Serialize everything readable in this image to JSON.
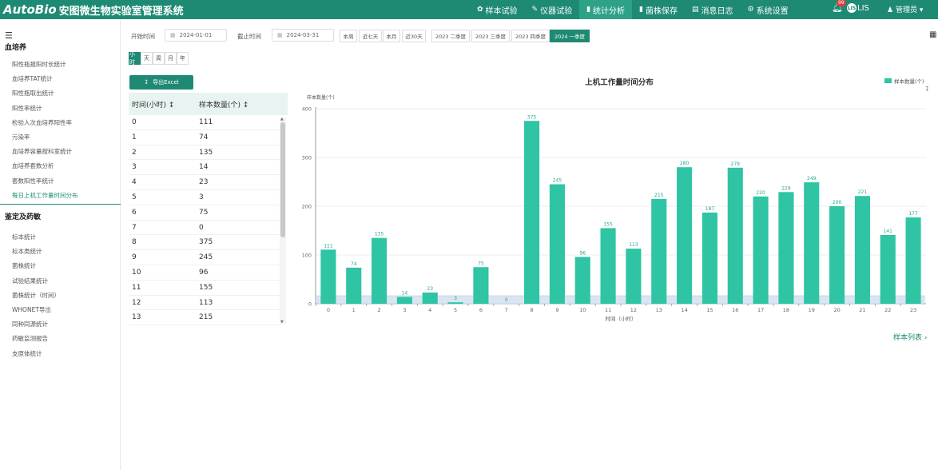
{
  "app": {
    "brand": "AutoBio",
    "system_name": "安图微生物实验室管理系统"
  },
  "nav": [
    {
      "icon": "flask-icon",
      "glyph": "✿",
      "label": "样本试验"
    },
    {
      "icon": "pen-icon",
      "glyph": "✎",
      "label": "仪器试验"
    },
    {
      "icon": "bar-chart-icon",
      "glyph": "▮",
      "label": "统计分析"
    },
    {
      "icon": "archive-icon",
      "glyph": "▮",
      "label": "菌株保存"
    },
    {
      "icon": "document-icon",
      "glyph": "▤",
      "label": "消息日志"
    },
    {
      "icon": "gear-icon",
      "glyph": "⚙",
      "label": "系统设置"
    }
  ],
  "header": {
    "bell_badge": "99",
    "lis_label": "LIS",
    "lis_badge": "LIS",
    "user": "管理员"
  },
  "sidebar": {
    "group1": "血培养",
    "group1_items": [
      "阳性瓶报阳时长统计",
      "血培养TAT统计",
      "阳性瓶取出统计",
      "阳性率统计",
      "检验人次血培养阳性率",
      "污染率",
      "血培养容量按科室统计",
      "血培养套数分析",
      "套数阳性率统计",
      "每日上机工作量时间分布"
    ],
    "group2": "鉴定及药敏",
    "group2_items": [
      "标本统计",
      "标本类统计",
      "菌株统计",
      "试验结果统计",
      "菌株统计（时间）",
      "WHONET导出",
      "同种同源统计",
      "药敏监测报告",
      "支原体统计"
    ]
  },
  "filters": {
    "start_label": "开始时间",
    "start_value": "2024-01-01",
    "end_label": "截止时间",
    "end_value": "2024-03-31",
    "quick": [
      "本周",
      "近七天",
      "本月",
      "近30天",
      "2023 二季度",
      "2023 三季度",
      "2023 四季度",
      "2024 一季度"
    ],
    "granularity": [
      "小时",
      "天",
      "周",
      "月",
      "年"
    ]
  },
  "export_label": "导出Excel",
  "table": {
    "headers": [
      "时间(小时)",
      "样本数量(个)"
    ],
    "rows": [
      [
        "0",
        "111"
      ],
      [
        "1",
        "74"
      ],
      [
        "2",
        "135"
      ],
      [
        "3",
        "14"
      ],
      [
        "4",
        "23"
      ],
      [
        "5",
        "3"
      ],
      [
        "6",
        "75"
      ],
      [
        "7",
        "0"
      ],
      [
        "8",
        "375"
      ],
      [
        "9",
        "245"
      ],
      [
        "10",
        "96"
      ],
      [
        "11",
        "155"
      ],
      [
        "12",
        "113"
      ],
      [
        "13",
        "215"
      ]
    ]
  },
  "chart_data": {
    "type": "bar",
    "title": "上机工作量时间分布",
    "ylabel": "样本数量(个)",
    "xlabel": "时间（小时）",
    "legend": "样本数量(个)",
    "legend_position": "top-right",
    "color": "#2ec4a4",
    "ylim": [
      0,
      400
    ],
    "yticks": [
      0,
      100,
      200,
      300,
      400
    ],
    "categories": [
      "0",
      "1",
      "2",
      "3",
      "4",
      "5",
      "6",
      "7",
      "8",
      "9",
      "10",
      "11",
      "12",
      "13",
      "14",
      "15",
      "16",
      "17",
      "18",
      "19",
      "20",
      "21",
      "22",
      "23"
    ],
    "values": [
      111,
      74,
      135,
      14,
      23,
      3,
      75,
      0,
      375,
      245,
      96,
      155,
      113,
      215,
      280,
      187,
      279,
      220,
      229,
      249,
      200,
      221,
      141,
      177
    ],
    "grid": true
  },
  "list_link": "样本列表 ›"
}
